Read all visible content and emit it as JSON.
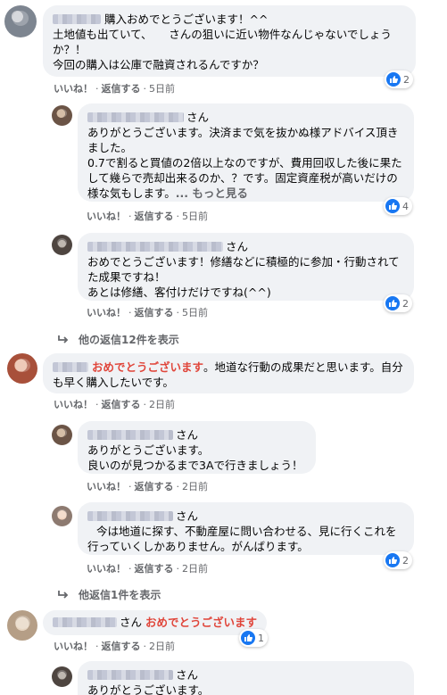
{
  "actions": {
    "like": "いいね！",
    "reply": "返信する",
    "sep": "·"
  },
  "comments": [
    {
      "name_suffix": "",
      "text": "購入おめでとうございます！^^\n土地値も出ていて、　　さんの狙いに近い物件なんじゃないでしょうか？！\n今回の購入は公庫で融資されるんですか？",
      "time": "5日前",
      "reactions": "2"
    },
    {
      "name_suffix": "さん",
      "text": "ありがとうございます。決済まで気を抜かぬ様アドバイス頂きました。\n0.7で割ると買値の2倍以上なのですが、費用回収した後に果たして幾らで売却出来るのか、？です。固定資産税が高いだけの様な気もします。",
      "see_more": "... もっと見る",
      "time": "5日前",
      "reactions": "4"
    },
    {
      "name_suffix": "さん",
      "text": "おめでとうございます！修繕などに積極的に参加・行動されてた成果ですね！\nあとは修繕、客付けだけですね(^^)",
      "time": "5日前",
      "reactions": "2"
    },
    {
      "more_replies": "他の返信12件を表示"
    },
    {
      "name_suffix": "",
      "highlight": "おめでとうございます",
      "text": "。地道な行動の成果だと思います。自分も早く購入したいです。",
      "time": "2日前"
    },
    {
      "name_suffix": "さん",
      "text": "ありがとうございます。\n良いのが見つかるまで3Aで行きましょう！",
      "time": "2日前"
    },
    {
      "name_suffix": "さん",
      "text": "今は地道に探す、不動産屋に問い合わせる、見に行くこれを行っていくしかありません。がんばります。",
      "time": "2日前",
      "reactions": "2"
    },
    {
      "more_replies": "他返信1件を表示"
    },
    {
      "name_suffix": "さん",
      "highlight": "おめでとうございます",
      "time": "2日前",
      "reactions": "1"
    },
    {
      "name_suffix": "さん",
      "text": "ありがとうございます。"
    }
  ],
  "colors": {
    "highlight": "#e0453a",
    "like_blue": "#1877f2",
    "bubble": "#f0f2f5"
  }
}
